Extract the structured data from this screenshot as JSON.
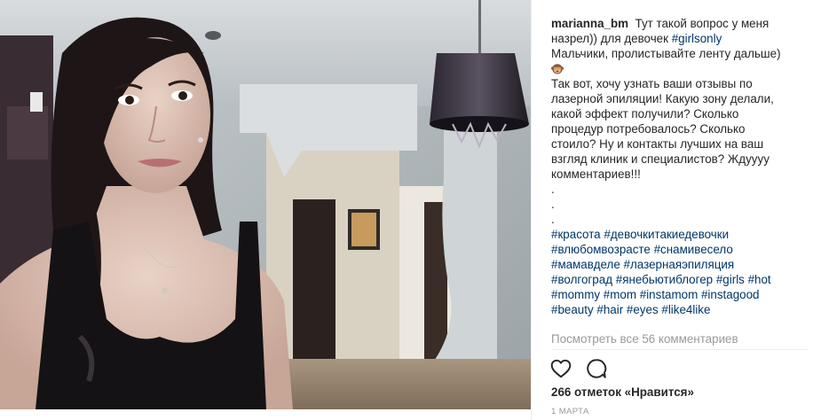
{
  "post": {
    "username": "marianna_bm",
    "caption_lines": [
      "Тут такой вопрос у меня",
      "назрел)) для девочек ",
      "Мальчики, пролистывайте ленту дальше)",
      "Так вот, хочу узнать ваши отзывы по",
      "лазерной эпиляции! Какую зону делали,",
      "какой эффект получили? Сколько",
      "процедур потребовалось? Сколько",
      "стоило? Ну и контакты лучших на ваш",
      "взгляд клиник и специалистов? Ждуууу",
      "комментариев!!!",
      ".",
      ".",
      "."
    ],
    "inline_hashtag": "#girlsonly",
    "emoji_icon": "monkey-emoji",
    "hashtag_lines": [
      [
        "#красота",
        "#девочкитакиедевочки"
      ],
      [
        "#влюбомвозрасте",
        "#снамивесело"
      ],
      [
        "#мамавделе",
        "#лазернаяэпиляция"
      ],
      [
        "#волгоград",
        "#янебьютиблогер",
        "#girls",
        "#hot"
      ],
      [
        "#mommy",
        "#mom",
        "#instamom",
        "#instagood"
      ],
      [
        "#beauty",
        "#hair",
        "#eyes",
        "#like4like"
      ]
    ],
    "view_comments": "Посмотреть все 56 комментариев",
    "likes": "266 отметок «Нравится»",
    "date": "1 МАРТА"
  },
  "icons": {
    "like": "heart-icon",
    "comment": "speech-bubble-icon"
  },
  "colors": {
    "text": "#262626",
    "hashtag": "#003569",
    "muted": "#999999",
    "divider": "#efefef"
  }
}
